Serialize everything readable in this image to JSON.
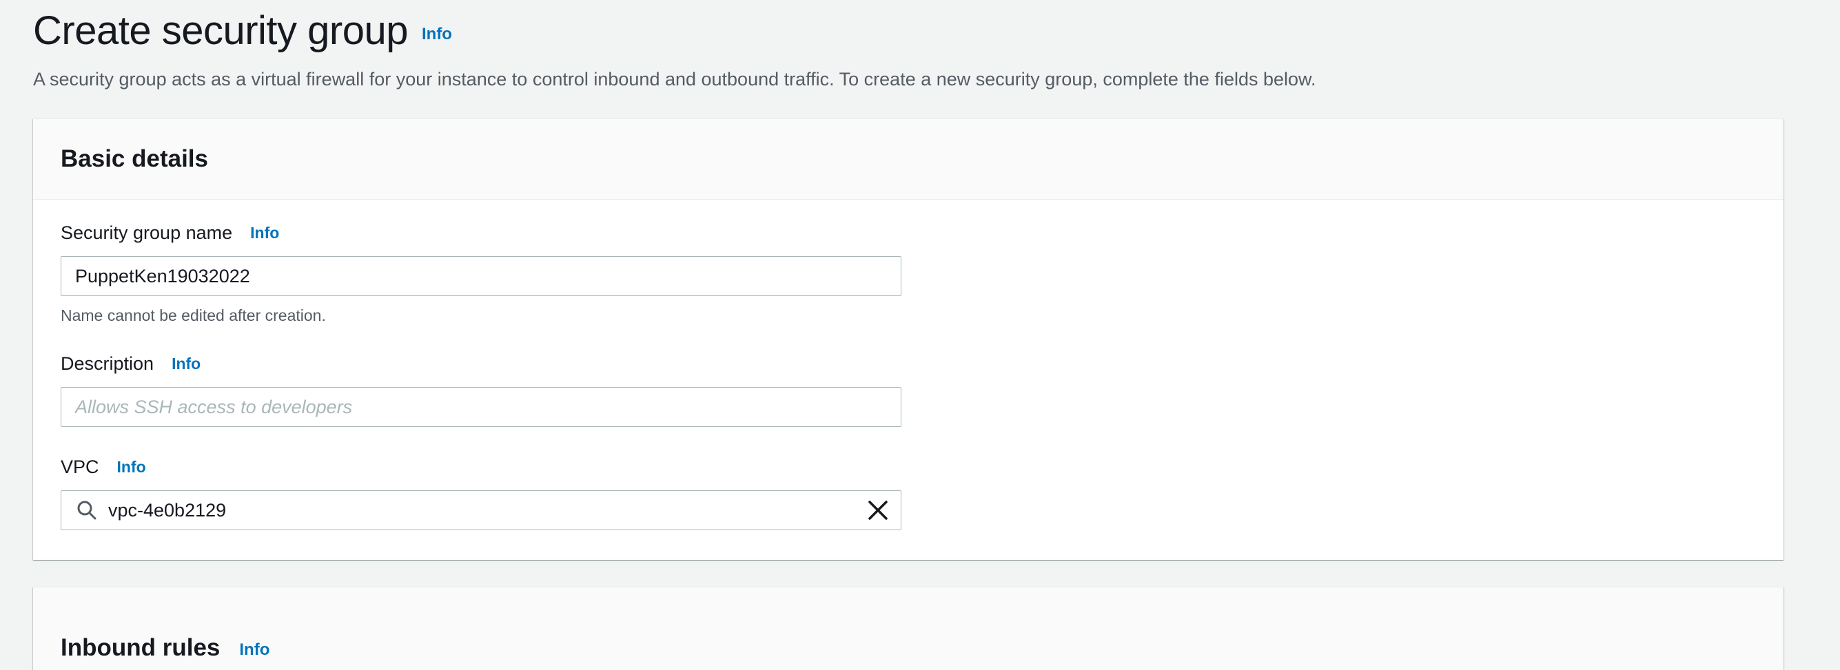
{
  "header": {
    "title": "Create security group",
    "info_label": "Info",
    "description": "A security group acts as a virtual firewall for your instance to control inbound and outbound traffic. To create a new security group, complete the fields below."
  },
  "basic_details": {
    "title": "Basic details",
    "fields": {
      "name": {
        "label": "Security group name",
        "info_label": "Info",
        "value": "PuppetKen19032022",
        "constraint": "Name cannot be edited after creation."
      },
      "description": {
        "label": "Description",
        "info_label": "Info",
        "value": "",
        "placeholder": "Allows SSH access to developers"
      },
      "vpc": {
        "label": "VPC",
        "info_label": "Info",
        "value": "vpc-4e0b2129",
        "icon": "search-icon",
        "clear_icon": "close-icon"
      }
    }
  },
  "inbound_rules": {
    "title": "Inbound rules",
    "info_label": "Info"
  },
  "colors": {
    "link": "#0073bb",
    "background": "#f2f3f3",
    "text": "#16191f",
    "secondary_text": "#545b64",
    "input_border": "#aab7b8"
  }
}
